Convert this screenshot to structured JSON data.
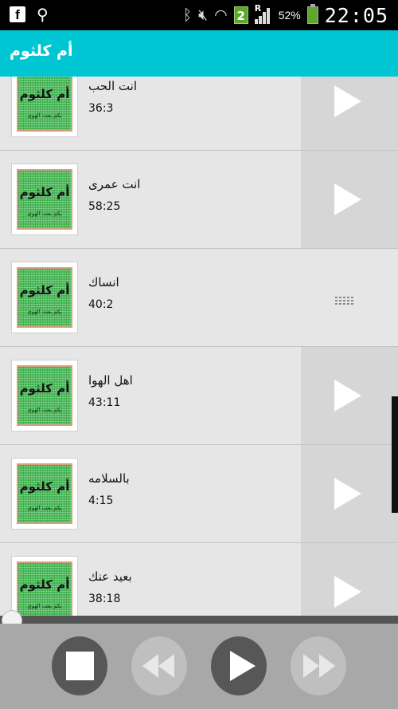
{
  "status_bar": {
    "battery_percent": "52%",
    "sim_badge": "2",
    "roaming_letter": "R",
    "clock": "22:05"
  },
  "app": {
    "title": "أم كلثوم"
  },
  "thumbnail": {
    "art_main": "أم كلثوم",
    "art_sub": "بكم بعت الهوى"
  },
  "songs": [
    {
      "title": "انت الحب",
      "duration": "36:3",
      "state": "play"
    },
    {
      "title": "انت عمرى",
      "duration": "58:25",
      "state": "play"
    },
    {
      "title": "انساك",
      "duration": "40:2",
      "state": "playing"
    },
    {
      "title": "اهل الهوا",
      "duration": "43:11",
      "state": "play"
    },
    {
      "title": "بالسلامه",
      "duration": "4:15",
      "state": "play"
    },
    {
      "title": "بعيد عنك",
      "duration": "38:18",
      "state": "play"
    }
  ],
  "player": {
    "progress": 0.0
  },
  "colors": {
    "accent": "#00c6d3",
    "list_bg": "#e6e6e6",
    "play_panel": "#d6d6d6",
    "controls_bg": "#a8a8a8"
  }
}
